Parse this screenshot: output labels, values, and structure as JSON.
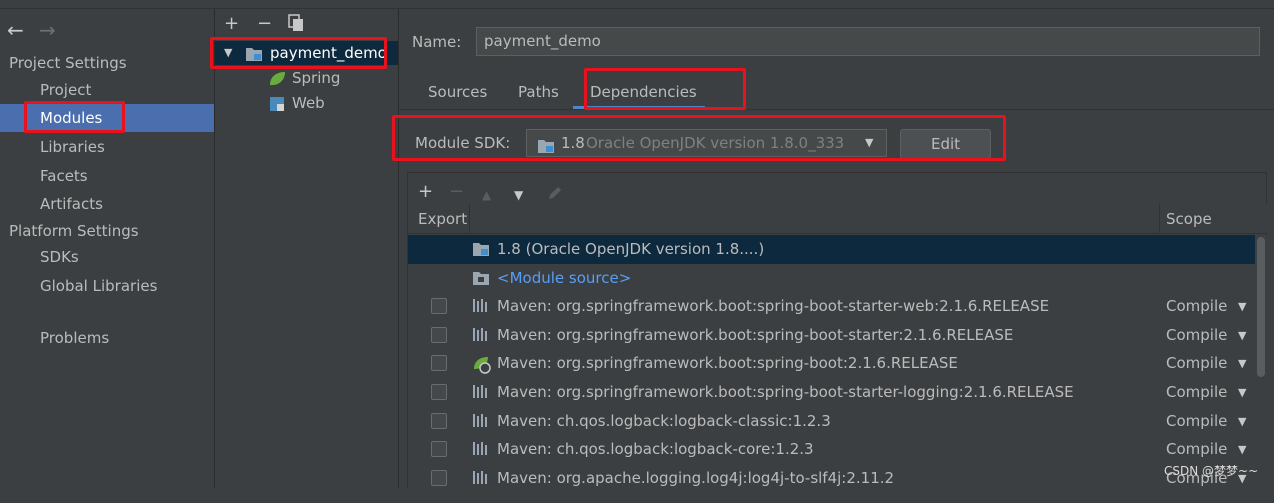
{
  "sidebar": {
    "project_settings_heading": "Project Settings",
    "platform_settings_heading": "Platform Settings",
    "items": {
      "project": "Project",
      "modules": "Modules",
      "libraries": "Libraries",
      "facets": "Facets",
      "artifacts": "Artifacts",
      "sdks": "SDKs",
      "global_libraries": "Global Libraries",
      "problems": "Problems"
    }
  },
  "tree": {
    "module": "payment_demo",
    "children": [
      "Spring",
      "Web"
    ]
  },
  "detail": {
    "name_label": "Name:",
    "name_value": "payment_demo",
    "tabs": [
      "Sources",
      "Paths",
      "Dependencies"
    ],
    "active_tab": "Dependencies",
    "sdk_label": "Module SDK:",
    "sdk_version": "1.8",
    "sdk_detail": "Oracle OpenJDK version 1.8.0_333",
    "edit_button": "Edit"
  },
  "table": {
    "headers": {
      "export": "Export",
      "scope": "Scope"
    },
    "rows": [
      {
        "text": "1.8 (Oracle OpenJDK version 1.8....)",
        "icon": "jdk-folder-icon",
        "checkbox": false,
        "scope": ""
      },
      {
        "text": "<Module source>",
        "icon": "module-source-folder-icon",
        "checkbox": false,
        "scope": ""
      },
      {
        "text": "Maven: org.springframework.boot:spring-boot-starter-web:2.1.6.RELEASE",
        "icon": "maven-library-icon",
        "checkbox": true,
        "scope": "Compile"
      },
      {
        "text": "Maven: org.springframework.boot:spring-boot-starter:2.1.6.RELEASE",
        "icon": "maven-library-icon",
        "checkbox": true,
        "scope": "Compile"
      },
      {
        "text": "Maven: org.springframework.boot:spring-boot:2.1.6.RELEASE",
        "icon": "spring-boot-library-icon",
        "checkbox": true,
        "scope": "Compile"
      },
      {
        "text": "Maven: org.springframework.boot:spring-boot-starter-logging:2.1.6.RELEASE",
        "icon": "maven-library-icon",
        "checkbox": true,
        "scope": "Compile"
      },
      {
        "text": "Maven: ch.qos.logback:logback-classic:1.2.3",
        "icon": "maven-library-icon",
        "checkbox": true,
        "scope": "Compile"
      },
      {
        "text": "Maven: ch.qos.logback:logback-core:1.2.3",
        "icon": "maven-library-icon",
        "checkbox": true,
        "scope": "Compile"
      },
      {
        "text": "Maven: org.apache.logging.log4j:log4j-to-slf4j:2.11.2",
        "icon": "maven-library-icon",
        "checkbox": true,
        "scope": "Compile"
      }
    ]
  },
  "watermark": "CSDN @梦梦~~",
  "colors": {
    "background": "#3c3f41",
    "selection": "#4b6eaf",
    "row_selection": "#0d293e",
    "link": "#589df6",
    "annotation_red": "#e8121e"
  }
}
